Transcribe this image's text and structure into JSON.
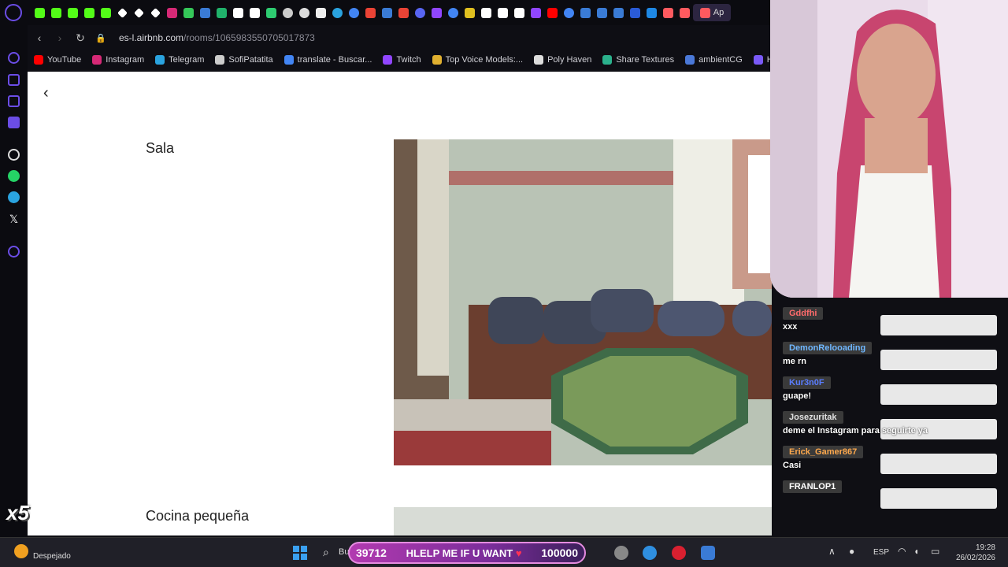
{
  "browser": {
    "url_host": "es-l.airbnb.com",
    "url_path": "/rooms/1065983550705017873",
    "active_tab_label": "Ap"
  },
  "bookmarks": [
    {
      "label": "YouTube",
      "color": "#ff0000"
    },
    {
      "label": "Instagram",
      "color": "#d62976"
    },
    {
      "label": "Telegram",
      "color": "#2aa3df"
    },
    {
      "label": "SofiPatatita",
      "color": "#cccccc"
    },
    {
      "label": "translate - Buscar...",
      "color": "#4285f4"
    },
    {
      "label": "Twitch",
      "color": "#9146ff"
    },
    {
      "label": "Top Voice Models:...",
      "color": "#e0b030"
    },
    {
      "label": "Poly Haven",
      "color": "#dddddd"
    },
    {
      "label": "Share Textures",
      "color": "#2bb18c"
    },
    {
      "label": "ambientCG",
      "color": "#4a78d8"
    },
    {
      "label": "Ha",
      "color": "#7a5af8"
    }
  ],
  "page": {
    "heading_1": "Sala",
    "heading_2": "Cocina pequeña"
  },
  "chat": [
    {
      "user": "Gddfhi",
      "user_color": "#ff6b6b",
      "text": "xxx"
    },
    {
      "user": "DemonRelooading",
      "user_color": "#6fb7ff",
      "text": "me rn"
    },
    {
      "user": "Kur3n0F",
      "user_color": "#5a7dff",
      "text": "guape!"
    },
    {
      "user": "Josezuritak",
      "user_color": "#e0e0e0",
      "text": "deme el Instagram para seguirte ya"
    },
    {
      "user": "Erick_Gamer867",
      "user_color": "#ffa94d",
      "text": "Casi"
    },
    {
      "user": "FRANLOP1",
      "user_color": "#ffffff",
      "text": ""
    }
  ],
  "goal": {
    "current": "39712",
    "message": "HLELP ME IF U WANT",
    "target": "100000"
  },
  "taskbar": {
    "weather": "Despejado",
    "search_hint": "Bu",
    "lang": "ESP",
    "time": "19:28",
    "date": "26/02/2026"
  },
  "overlay_badge": "x5"
}
